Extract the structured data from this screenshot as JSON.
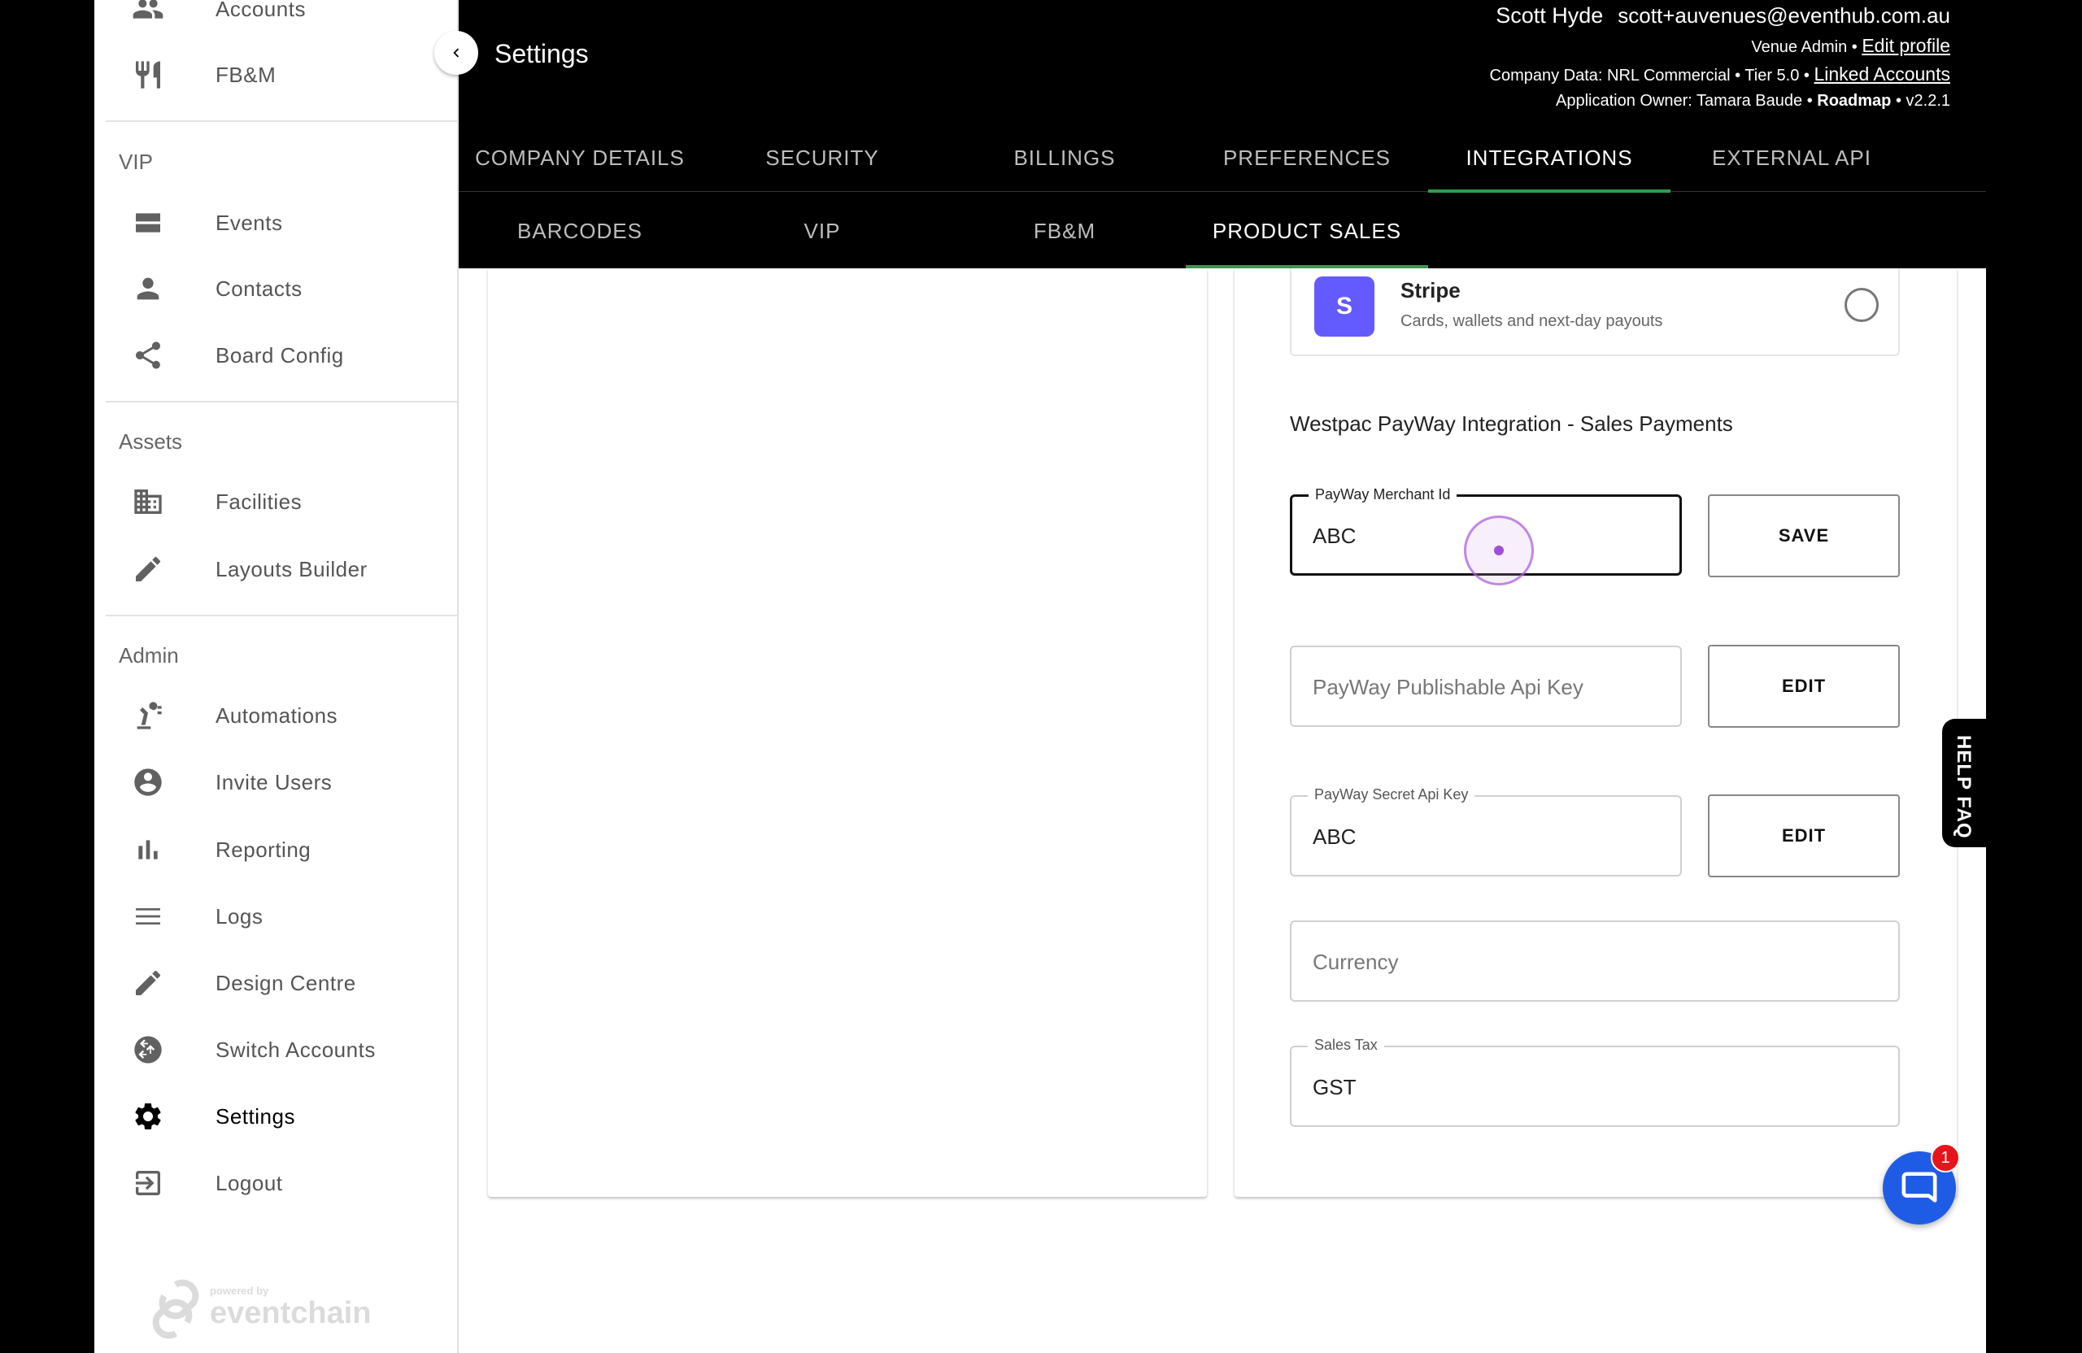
{
  "sidebar": {
    "top_items": [
      {
        "label": "Accounts",
        "icon": "people-icon"
      },
      {
        "label": "FB&M",
        "icon": "restaurant-icon"
      }
    ],
    "sections": {
      "vip": "VIP",
      "assets": "Assets",
      "admin": "Admin"
    },
    "vip_items": [
      {
        "label": "Events",
        "icon": "events-icon"
      },
      {
        "label": "Contacts",
        "icon": "person-icon"
      },
      {
        "label": "Board Config",
        "icon": "share-icon"
      }
    ],
    "asset_items": [
      {
        "label": "Facilities",
        "icon": "building-icon"
      },
      {
        "label": "Layouts Builder",
        "icon": "pencil-icon"
      }
    ],
    "admin_items": [
      {
        "label": "Automations",
        "icon": "robot-arm-icon"
      },
      {
        "label": "Invite Users",
        "icon": "account-circle-icon"
      },
      {
        "label": "Reporting",
        "icon": "bar-chart-icon"
      },
      {
        "label": "Logs",
        "icon": "lines-icon"
      },
      {
        "label": "Design Centre",
        "icon": "pencil-icon"
      },
      {
        "label": "Switch Accounts",
        "icon": "switch-icon"
      },
      {
        "label": "Settings",
        "icon": "gear-icon"
      },
      {
        "label": "Logout",
        "icon": "logout-icon"
      }
    ],
    "powered_by": {
      "small": "powered by",
      "brand": "eventchain"
    }
  },
  "header": {
    "title": "Settings",
    "user_name": "Scott Hyde",
    "user_email": "scott+auvenues@eventhub.com.au",
    "role": "Venue Admin",
    "edit_profile": "Edit profile",
    "company_data": "Company Data: NRL Commercial • Tier 5.0 •",
    "linked_accounts": "Linked Accounts",
    "app_owner": "Application Owner: Tamara Baude •",
    "roadmap": "Roadmap",
    "version": "• v2.2.1"
  },
  "tabs_primary": [
    {
      "label": "COMPANY DETAILS",
      "active": false
    },
    {
      "label": "SECURITY",
      "active": false
    },
    {
      "label": "BILLINGS",
      "active": false
    },
    {
      "label": "PREFERENCES",
      "active": false
    },
    {
      "label": "INTEGRATIONS",
      "active": true
    },
    {
      "label": "EXTERNAL API",
      "active": false
    }
  ],
  "tabs_secondary": [
    {
      "label": "BARCODES",
      "active": false
    },
    {
      "label": "VIP",
      "active": false
    },
    {
      "label": "FB&M",
      "active": false
    },
    {
      "label": "PRODUCT SALES",
      "active": true
    }
  ],
  "stripe": {
    "logo_letter": "S",
    "name": "Stripe",
    "description": "Cards, wallets and next-day payouts",
    "selected": false
  },
  "payway": {
    "heading": "Westpac PayWay Integration - Sales Payments",
    "merchant_id_label": "PayWay Merchant Id",
    "merchant_id_value": "ABC",
    "save_label": "SAVE",
    "publishable_placeholder": "PayWay Publishable Api Key",
    "edit_label": "EDIT",
    "secret_label": "PayWay Secret Api Key",
    "secret_value": "ABC",
    "currency_placeholder": "Currency",
    "sales_tax_label": "Sales Tax",
    "sales_tax_value": "GST"
  },
  "help": {
    "label": "HELP FAQ"
  },
  "chat": {
    "badge": "1"
  },
  "colors": {
    "accent": "#2e9e4f",
    "stripe": "#635bff",
    "chat": "#1f5ce6",
    "badge": "#e8141b"
  }
}
